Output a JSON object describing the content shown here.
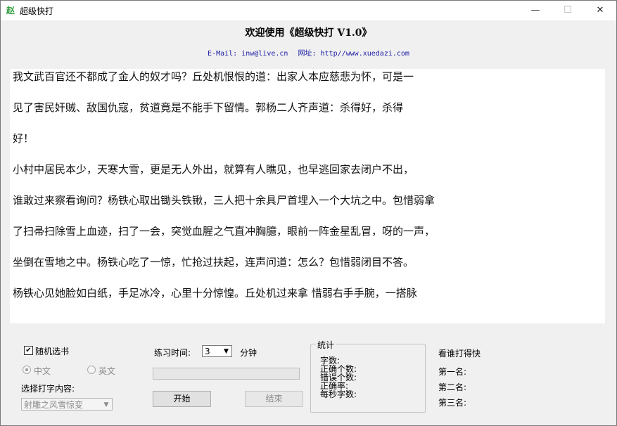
{
  "window": {
    "title": "超级快打",
    "app_icon": "app-logo-icon",
    "app_icon_glyph": "赵",
    "controls": {
      "minimize": "—",
      "maximize": "☐",
      "close": "✕"
    }
  },
  "header": {
    "welcome": "欢迎使用《超级快打 V1.0》",
    "email_label": "E-Mail: inw@live.cn",
    "site_label": "网址: http//www.xuedazi.com"
  },
  "text_area": {
    "lines": [
      "我文武百官还不都成了金人的奴才吗？丘处机恨恨的道：出家人本应慈悲为怀，可是一",
      "见了害民奸贼、敌国仇寇，贫道竟是不能手下留情。郭杨二人齐声道：杀得好，杀得",
      "好！",
      "小村中居民本少，天寒大雪，更是无人外出，就算有人瞧见，也早逃回家去闭户不出，",
      "谁敢过来察看询问？杨铁心取出锄头铁锹，三人把十余具尸首埋入一个大坑之中。包惜弱拿",
      "了扫帚扫除雪上血迹，扫了一会，突觉血腥之气直冲胸臆，眼前一阵金星乱冒，呀的一声，",
      "坐倒在雪地之中。杨铁心吃了一惊，忙抢过扶起，连声问道：怎么？包惜弱闭目不答。",
      "杨铁心见她脸如白纸，手足冰冷，心里十分惊惶。丘处机过来拿  惜弱右手手腕，一搭脉"
    ]
  },
  "controls": {
    "random_book": {
      "label": "随机选书",
      "checked": true,
      "check_glyph": "✔"
    },
    "lang_zh": {
      "label": "中文",
      "selected": true
    },
    "lang_en": {
      "label": "英文",
      "selected": false
    },
    "content_label": "选择打字内容:",
    "content_value": "射雕之风雪惊变",
    "dropdown_arrow": "▼",
    "time_label": "练习时间:",
    "time_value": "3",
    "time_unit": "分钟",
    "progress": 0,
    "start_label": "开始",
    "end_label": "结束"
  },
  "stats": {
    "title": "统计",
    "chars": "字数:",
    "correct": "正确个数:",
    "wrong": "错误个数:",
    "accuracy": "正确率:",
    "speed": "每秒字数:"
  },
  "ranking": {
    "title": "看谁打得快",
    "first": "第一名:",
    "second": "第二名:",
    "third": "第三名:"
  },
  "colors": {
    "link": "#1a1aa6",
    "progress_fill": "#06b025",
    "icon_green": "#2e9e3c"
  }
}
